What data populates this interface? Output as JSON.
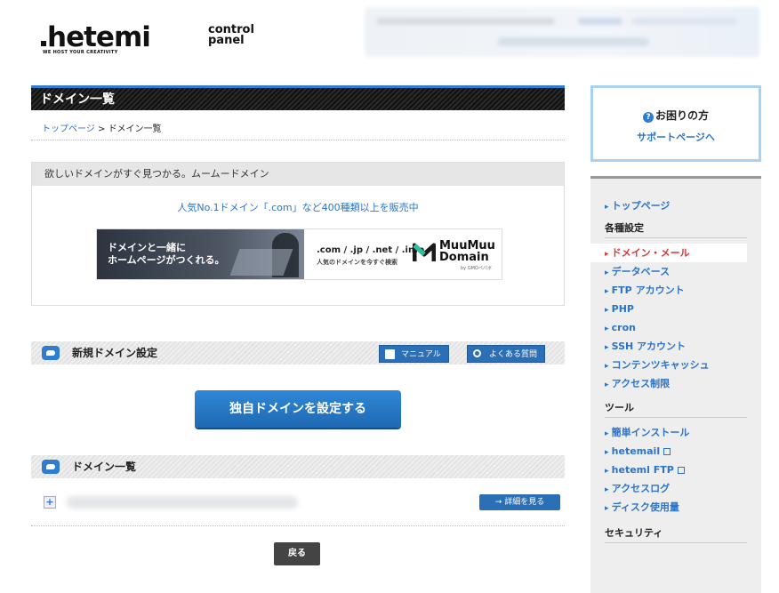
{
  "header": {
    "logo_main": "hetemi",
    "logo_sub_1": "control",
    "logo_sub_2": "panel",
    "logo_tag": "WE HOST YOUR CREATIVITY"
  },
  "page": {
    "title": "ドメイン一覧",
    "breadcrumb": {
      "home": "トップページ",
      "separator": " > ",
      "current": "ドメイン一覧"
    }
  },
  "promo": {
    "heading": "欲しいドメインがすぐ見つかる。ムームードメイン",
    "link": "人気No.1ドメイン「.com」など400種類以上を販売中",
    "banner": {
      "left_line1": "ドメインと一緒に",
      "left_line2": "ホームページがつくれる。",
      "tlds": ".com / .jp / .net / .info",
      "tlds_sub": "人気のドメインを今すぐ検索",
      "brand_1": "MuuMuu",
      "brand_2": "Domain",
      "brand_by": "by GMOペパボ"
    }
  },
  "new_domain": {
    "title": "新規ドメイン設定",
    "manual_label": "マニュアル",
    "faq_label": "よくある質問",
    "primary_button": "独自ドメインを設定する"
  },
  "domain_list": {
    "title": "ドメイン一覧",
    "expand": "+",
    "detail_button": "→ 詳細を見る",
    "back_button": "戻る"
  },
  "help": {
    "title": "お困りの方",
    "icon": "?",
    "link": "サポートページへ"
  },
  "sidebar": {
    "top": "トップページ",
    "settings_heading": "各種設定",
    "settings": [
      "ドメイン・メール",
      "データベース",
      "FTP アカウント",
      "PHP",
      "cron",
      "SSH アカウント",
      "コンテンツキャッシュ",
      "アクセス制限"
    ],
    "tools_heading": "ツール",
    "tools": [
      "簡単インストール",
      "hetemail",
      "heteml FTP",
      "アクセスログ",
      "ディスク使用量"
    ],
    "security_heading": "セキュリティ"
  },
  "colors": {
    "accent": "#2b74c9",
    "active": "#dd3333",
    "primary_button": "#2f88d6"
  }
}
